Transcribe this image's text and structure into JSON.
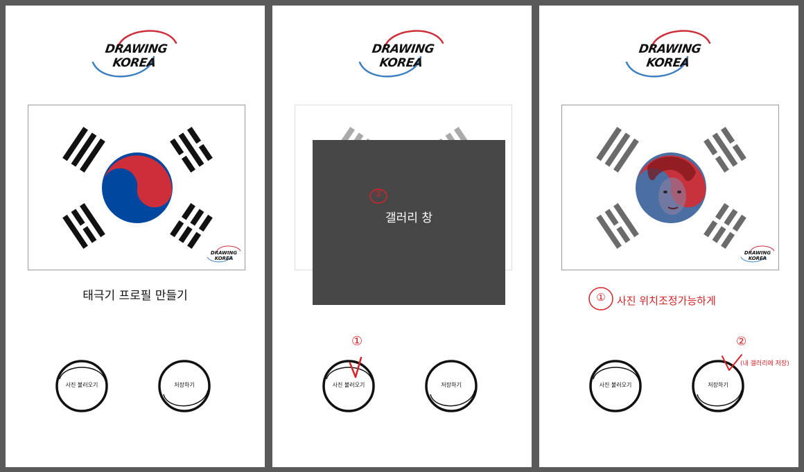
{
  "logo": {
    "text": "DRAWING KOREA"
  },
  "mini_logo": {
    "text": "DRAWING KOREA"
  },
  "panels": [
    {
      "title": "태극기 프로필 만들기",
      "load_button": "사진 불러오기",
      "save_button": "저장하기"
    },
    {
      "gallery_label": "갤러리 창",
      "load_button": "사진 불러오기",
      "save_button": "저장하기",
      "annotations": {
        "marker_1": "①",
        "marker_2": "②"
      }
    },
    {
      "annotation_text": "사진 위치조정가능하게",
      "annotation_marker_1": "①",
      "annotation_marker_2": "②",
      "annotation_note": "(내 갤러리에 저장)",
      "load_button": "사진 불러오기",
      "save_button": "저장하기"
    }
  ],
  "colors": {
    "red": "#cd2e3a",
    "blue": "#0047a0",
    "annotation_red": "#d52328",
    "modal_gray": "#474747",
    "trigram_gray": "#6b6b6b"
  }
}
